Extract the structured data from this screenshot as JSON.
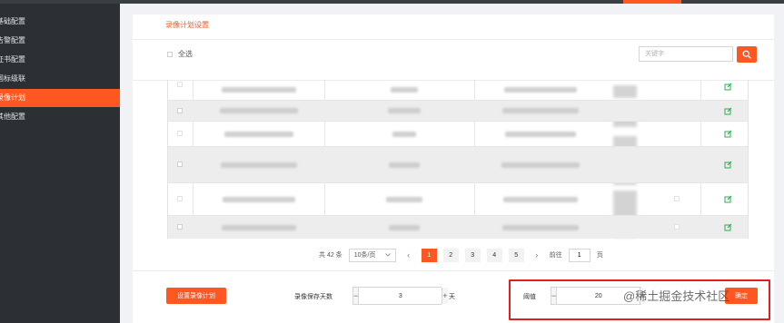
{
  "sidebar": {
    "items": [
      {
        "label": "基础配置"
      },
      {
        "label": "告警配置"
      },
      {
        "label": "证书配置"
      },
      {
        "label": "国标级联"
      },
      {
        "label": "录像计划",
        "active": true
      },
      {
        "label": "其他配置"
      }
    ]
  },
  "main": {
    "title": "录像计划设置"
  },
  "filter": {
    "select_all_label": "全选",
    "search_placeholder": "关键字"
  },
  "icons": {
    "search": "search-icon",
    "edit": "edit-icon",
    "prev": "chevron-left-icon",
    "next": "chevron-right-icon"
  },
  "pagination": {
    "total_text": "共 42 条",
    "page_size_text": "10条/页",
    "pages": [
      "1",
      "2",
      "3",
      "4",
      "5"
    ],
    "current_page": "1",
    "goto_label": "前往",
    "goto_value": "1",
    "goto_suffix": "页"
  },
  "footer": {
    "set_plan_button": "设置录像计划",
    "retention_label": "录像保存天数",
    "retention_value": "3",
    "retention_unit": "天",
    "threshold_label": "阈值",
    "threshold_value": "20",
    "confirm_button": "确定"
  },
  "watermark": "@稀土掘金技术社区",
  "colors": {
    "accent": "#ff5722",
    "sidebar_bg": "#2c3035",
    "highlight_box": "#e02020",
    "edit_icon": "#34a853"
  }
}
